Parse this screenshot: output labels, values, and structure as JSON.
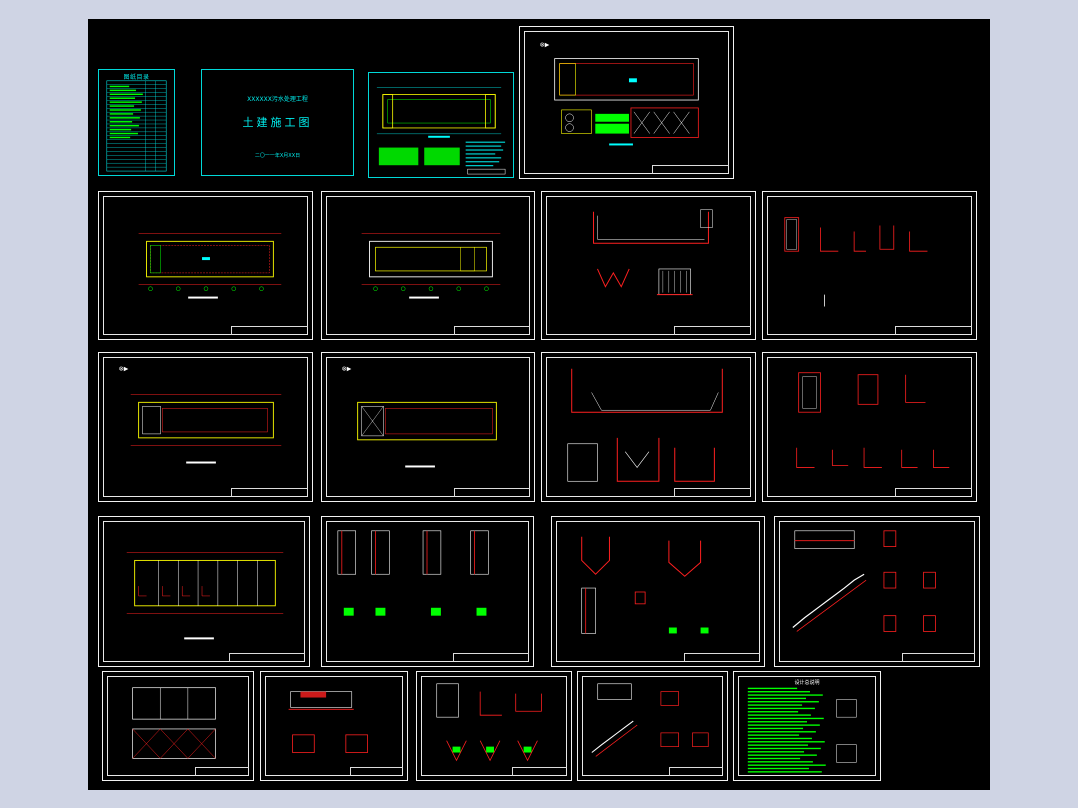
{
  "index_sheet": {
    "title": "图纸目录"
  },
  "cover_sheet": {
    "title": "XXXXXX污水处理工程",
    "subtitle": "土建施工图",
    "date": "二〇一一年X月XX日"
  },
  "notes_sheet": {
    "title": "设计总说明"
  },
  "sheet_groups": {
    "row1_count": 4,
    "row2_count": 4,
    "row3_count": 4,
    "row4_count": 4,
    "row5_count": 5
  },
  "colors": {
    "background": "#cfd4e4",
    "canvas": "#000000",
    "frame": "#ffffff",
    "cyan": "#00e5e5",
    "yellow": "#ffff00",
    "red": "#ff2020",
    "green": "#00ff00"
  }
}
